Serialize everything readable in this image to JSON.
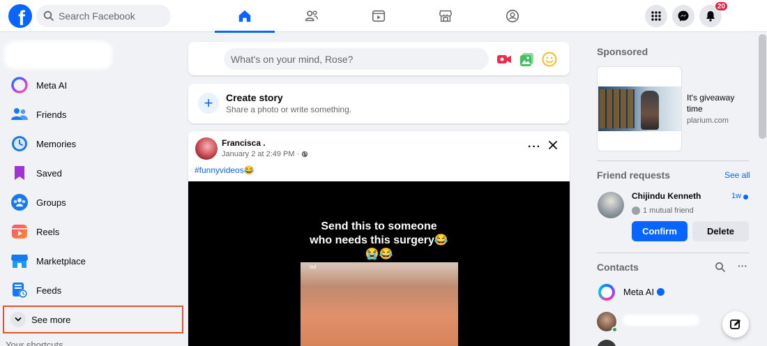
{
  "header": {
    "logo_letter": "f",
    "search_placeholder": "Search Facebook",
    "nav_tabs": [
      {
        "name": "home-icon",
        "active": true
      },
      {
        "name": "friends-icon",
        "active": false
      },
      {
        "name": "video-icon",
        "active": false
      },
      {
        "name": "marketplace-icon",
        "active": false
      },
      {
        "name": "groups-icon",
        "active": false
      }
    ],
    "notification_count": "20"
  },
  "sidebar": {
    "items": [
      {
        "label": "Meta AI",
        "icon": "meta-ai-icon"
      },
      {
        "label": "Friends",
        "icon": "friends-icon"
      },
      {
        "label": "Memories",
        "icon": "memories-icon"
      },
      {
        "label": "Saved",
        "icon": "saved-icon"
      },
      {
        "label": "Groups",
        "icon": "groups-icon"
      },
      {
        "label": "Reels",
        "icon": "reels-icon"
      },
      {
        "label": "Marketplace",
        "icon": "marketplace-icon"
      },
      {
        "label": "Feeds",
        "icon": "feeds-icon"
      }
    ],
    "see_more": "See more",
    "shortcuts_peek": "Your shortcuts"
  },
  "composer": {
    "placeholder": "What's on your mind, Rose?"
  },
  "story": {
    "title": "Create story",
    "subtitle": "Share a photo or write something."
  },
  "post": {
    "author": "Francisca .",
    "time": "January 2 at 2:49 PM ·",
    "hashtag": "#funnyvideos",
    "hashtag_emoji": "😂",
    "caption_line1": "Send this to someone",
    "caption_line2": "who needs this surgery😂",
    "caption_line3": "😭😂",
    "video_label": "lad"
  },
  "right": {
    "sponsored_title": "Sponsored",
    "ad_text": "It's giveaway time",
    "ad_domain": "plarium.com",
    "friend_requests_title": "Friend requests",
    "see_all": "See all",
    "request_name": "Chijindu Kenneth",
    "request_time": "1w",
    "mutual": "1 mutual friend",
    "confirm": "Confirm",
    "delete": "Delete",
    "contacts_title": "Contacts",
    "contacts": [
      {
        "name": "Meta AI",
        "verified": true
      }
    ]
  },
  "colors": {
    "brand": "#0866ff",
    "highlight_border": "#e0532f",
    "badge": "#e41e3f"
  }
}
